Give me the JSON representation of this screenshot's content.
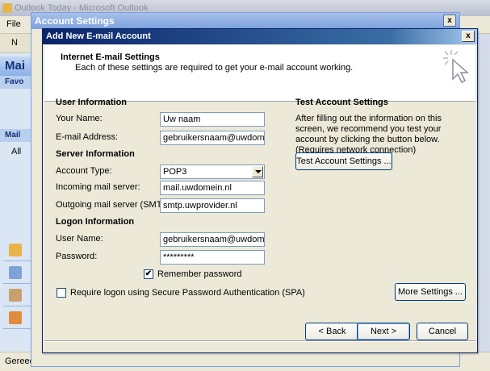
{
  "background": {
    "window_title": "Outlook Today - Microsoft Outlook",
    "menu_file": "File",
    "toolbar_new": "N",
    "nav_mail": "Mai",
    "nav_favorites": "Favo",
    "nav_mail_folders": "Mail",
    "nav_all": "All",
    "status_text": "Gereed"
  },
  "account_settings": {
    "title": "Account Settings",
    "close": "x"
  },
  "dialog": {
    "title": "Add New E-mail Account",
    "close": "x",
    "header_title": "Internet E-mail Settings",
    "header_desc": "Each of these settings are required to get your e-mail account working.",
    "user_info": {
      "heading": "User Information",
      "name_label": "Your Name:",
      "name_value": "Uw naam",
      "email_label": "E-mail Address:",
      "email_value": "gebruikersnaam@uwdomein.nl"
    },
    "server_info": {
      "heading": "Server Information",
      "account_type_label": "Account Type:",
      "account_type_value": "POP3",
      "incoming_label": "Incoming mail server:",
      "incoming_value": "mail.uwdomein.nl",
      "outgoing_label": "Outgoing mail server (SMTP):",
      "outgoing_value": "smtp.uwprovider.nl"
    },
    "logon_info": {
      "heading": "Logon Information",
      "username_label": "User Name:",
      "username_value": "gebruikersnaam@uwdomein.nl",
      "password_label": "Password:",
      "password_value": "*********",
      "remember_label": "Remember password",
      "remember_checked": "✔",
      "spa_label": "Require logon using Secure Password Authentication (SPA)"
    },
    "test_settings": {
      "heading": "Test Account Settings",
      "description": "After filling out the information on this screen, we recommend you test your account by clicking the button below. (Requires network connection)",
      "test_button": "Test Account Settings ..."
    },
    "more_settings_button": "More Settings ...",
    "back_button": "< Back",
    "next_button": "Next >",
    "cancel_button": "Cancel"
  }
}
